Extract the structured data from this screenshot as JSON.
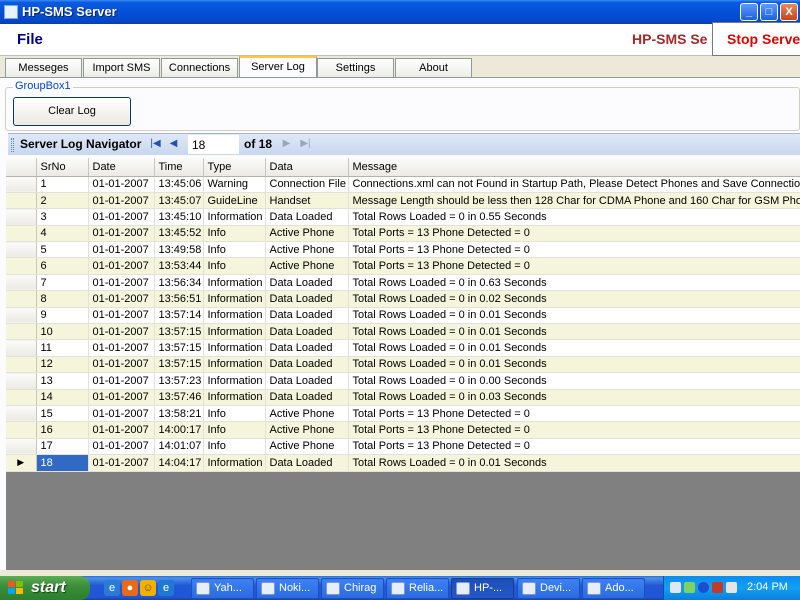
{
  "window": {
    "title": "HP-SMS Server",
    "minimize_glyph": "_",
    "maximize_glyph": "□",
    "close_glyph": "X"
  },
  "header": {
    "file_menu": "File",
    "brand": "HP-SMS Se",
    "stop_button": "Stop Serve"
  },
  "tabs": [
    "Messeges",
    "Import SMS",
    "Connections",
    "Server Log",
    "Settings",
    "About"
  ],
  "active_tab": "Server Log",
  "groupbox": {
    "title": "GroupBox1",
    "clear_button": "Clear Log"
  },
  "navigator": {
    "title": "Server Log Navigator",
    "position_value": "18",
    "of_text": "of 18",
    "icons": [
      "move-first-icon",
      "move-previous-icon",
      "move-next-icon",
      "move-last-icon"
    ]
  },
  "grid": {
    "columns": [
      "SrNo",
      "Date",
      "Time",
      "Type",
      "Data",
      "Message"
    ],
    "rows": [
      [
        "1",
        "01-01-2007",
        "13:45:06",
        "Warning",
        "Connection File",
        "Connections.xml can not Found in Startup Path, Please Detect Phones and Save Connectio"
      ],
      [
        "2",
        "01-01-2007",
        "13:45:07",
        "GuideLine",
        "Handset",
        "Message Length should be less then 128 Char for CDMA Phone and 160 Char for GSM Pho"
      ],
      [
        "3",
        "01-01-2007",
        "13:45:10",
        "Information",
        "Data Loaded",
        "Total Rows Loaded = 0  in  0.55 Seconds"
      ],
      [
        "4",
        "01-01-2007",
        "13:45:52",
        "Info",
        "Active Phone",
        "Total Ports = 13 Phone Detected = 0"
      ],
      [
        "5",
        "01-01-2007",
        "13:49:58",
        "Info",
        "Active Phone",
        "Total Ports = 13 Phone Detected = 0"
      ],
      [
        "6",
        "01-01-2007",
        "13:53:44",
        "Info",
        "Active Phone",
        "Total Ports = 13 Phone Detected = 0"
      ],
      [
        "7",
        "01-01-2007",
        "13:56:34",
        "Information",
        "Data Loaded",
        "Total Rows Loaded = 0  in  0.63 Seconds"
      ],
      [
        "8",
        "01-01-2007",
        "13:56:51",
        "Information",
        "Data Loaded",
        "Total Rows Loaded = 0  in  0.02 Seconds"
      ],
      [
        "9",
        "01-01-2007",
        "13:57:14",
        "Information",
        "Data Loaded",
        "Total Rows Loaded = 0  in  0.01 Seconds"
      ],
      [
        "10",
        "01-01-2007",
        "13:57:15",
        "Information",
        "Data Loaded",
        "Total Rows Loaded = 0  in  0.01 Seconds"
      ],
      [
        "11",
        "01-01-2007",
        "13:57:15",
        "Information",
        "Data Loaded",
        "Total Rows Loaded = 0  in  0.01 Seconds"
      ],
      [
        "12",
        "01-01-2007",
        "13:57:15",
        "Information",
        "Data Loaded",
        "Total Rows Loaded = 0  in  0.01 Seconds"
      ],
      [
        "13",
        "01-01-2007",
        "13:57:23",
        "Information",
        "Data Loaded",
        "Total Rows Loaded = 0  in  0.00 Seconds"
      ],
      [
        "14",
        "01-01-2007",
        "13:57:46",
        "Information",
        "Data Loaded",
        "Total Rows Loaded = 0  in  0.03 Seconds"
      ],
      [
        "15",
        "01-01-2007",
        "13:58:21",
        "Info",
        "Active Phone",
        "Total Ports = 13 Phone Detected = 0"
      ],
      [
        "16",
        "01-01-2007",
        "14:00:17",
        "Info",
        "Active Phone",
        "Total Ports = 13 Phone Detected = 0"
      ],
      [
        "17",
        "01-01-2007",
        "14:01:07",
        "Info",
        "Active Phone",
        "Total Ports = 13 Phone Detected = 0"
      ],
      [
        "18",
        "01-01-2007",
        "14:04:17",
        "Information",
        "Data Loaded",
        "Total Rows Loaded = 0  in  0.01 Seconds"
      ]
    ],
    "current_row": "18",
    "row_indicator_glyph": "▶",
    "alt_row_color": "#f5f5dc",
    "selection_color": "#316ac5"
  },
  "taskbar": {
    "start_label": "start",
    "quick_launch": [
      "ie-icon",
      "firefox-icon",
      "messenger-icon",
      "ie-alt-icon"
    ],
    "tasks": [
      "Yah...",
      "Noki...",
      "Chirag",
      "Relia...",
      "HP-...",
      "Devi...",
      "Ado..."
    ],
    "active_task": "HP-...",
    "tray_icons": [
      "printer-icon",
      "network-icon",
      "bluetooth-icon",
      "security-icon",
      "volume-icon"
    ],
    "clock": "2:04 PM"
  }
}
